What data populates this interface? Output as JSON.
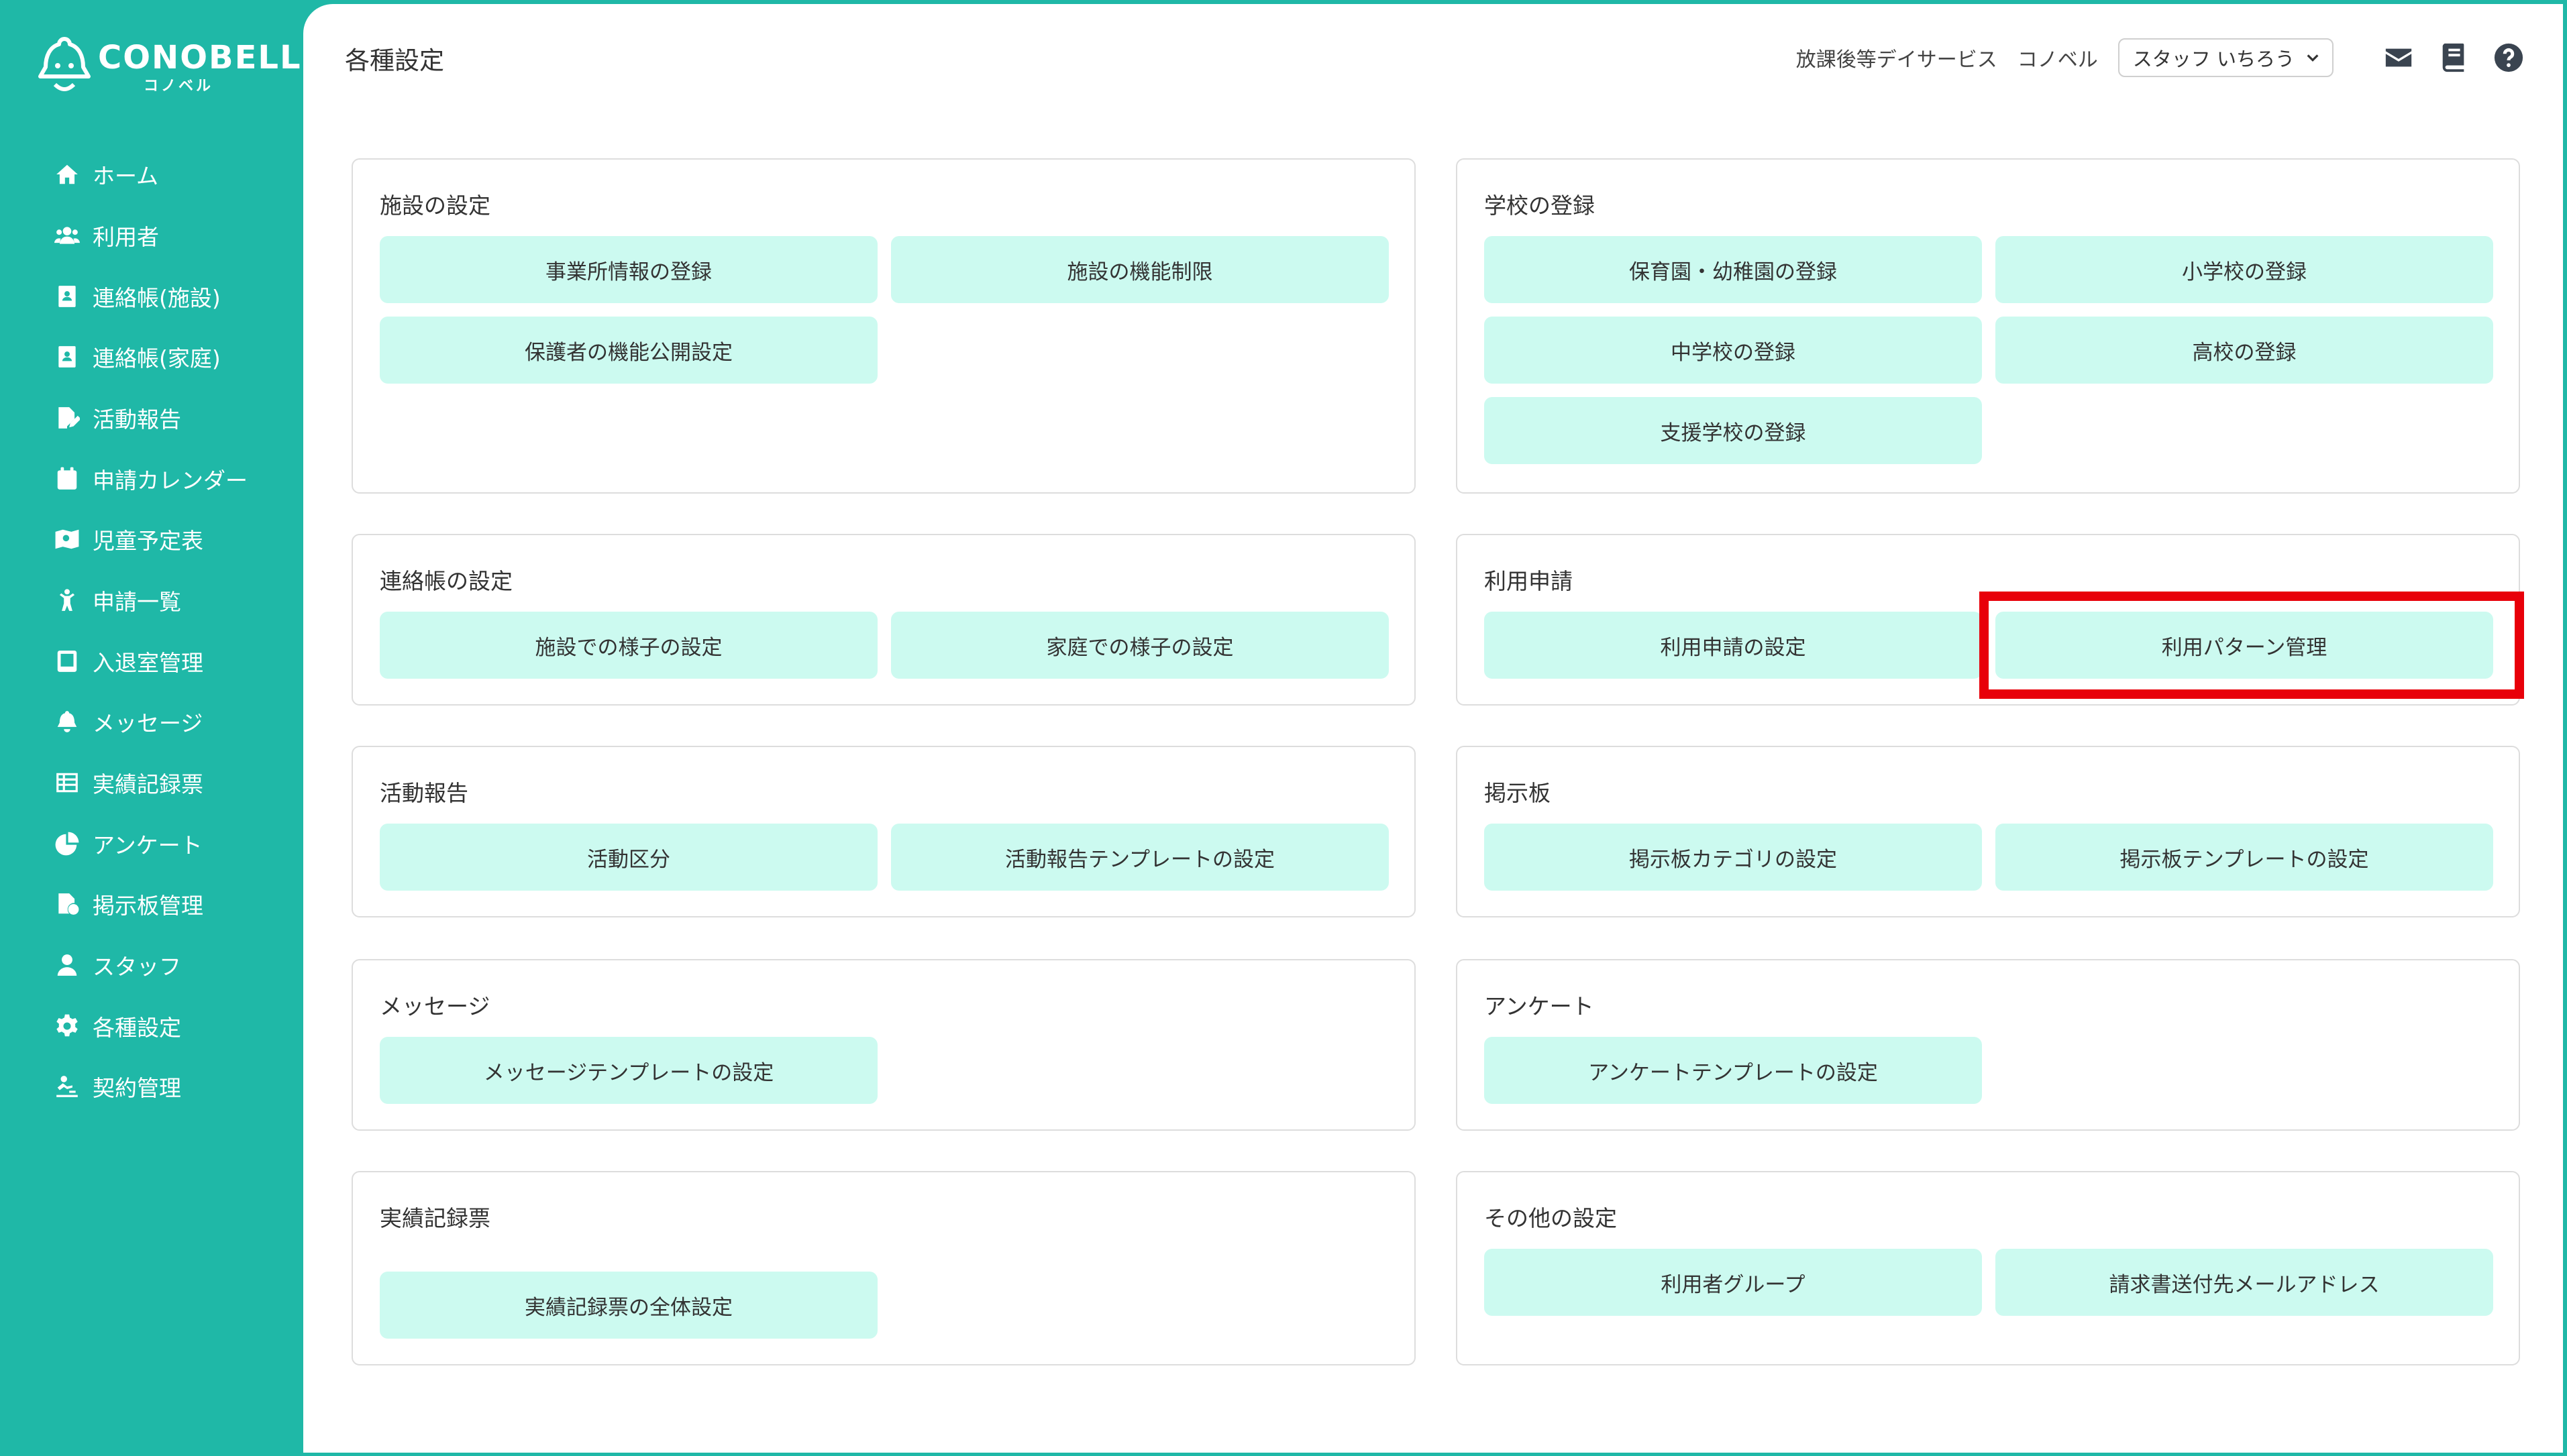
{
  "brand": {
    "name": "CONOBELL",
    "sub": "コノベル"
  },
  "sidebar": {
    "items": [
      {
        "label": "ホーム",
        "icon": "home-icon"
      },
      {
        "label": "利用者",
        "icon": "users-icon"
      },
      {
        "label": "連絡帳(施設)",
        "icon": "contact-book-icon"
      },
      {
        "label": "連絡帳(家庭)",
        "icon": "contact-book-icon"
      },
      {
        "label": "活動報告",
        "icon": "report-edit-icon"
      },
      {
        "label": "申請カレンダー",
        "icon": "calendar-icon"
      },
      {
        "label": "児童予定表",
        "icon": "map-icon"
      },
      {
        "label": "申請一覧",
        "icon": "child-icon"
      },
      {
        "label": "入退室管理",
        "icon": "tablet-icon"
      },
      {
        "label": "メッセージ",
        "icon": "bell-icon"
      },
      {
        "label": "実績記録票",
        "icon": "table-icon"
      },
      {
        "label": "アンケート",
        "icon": "pie-chart-icon"
      },
      {
        "label": "掲示板管理",
        "icon": "board-icon"
      },
      {
        "label": "スタッフ",
        "icon": "staff-icon"
      },
      {
        "label": "各種設定",
        "icon": "gear-icon"
      },
      {
        "label": "契約管理",
        "icon": "contract-icon"
      }
    ]
  },
  "header": {
    "title": "各種設定",
    "facility": "放課後等デイサービス",
    "org": "コノベル",
    "staff_select": "スタッフ いちろう"
  },
  "cards": {
    "facility": {
      "title": "施設の設定",
      "buttons": [
        "事業所情報の登録",
        "施設の機能制限",
        "保護者の機能公開設定"
      ]
    },
    "school": {
      "title": "学校の登録",
      "buttons": [
        "保育園・幼稚園の登録",
        "小学校の登録",
        "中学校の登録",
        "高校の登録",
        "支援学校の登録"
      ]
    },
    "contact": {
      "title": "連絡帳の設定",
      "buttons": [
        "施設での様子の設定",
        "家庭での様子の設定"
      ]
    },
    "usage": {
      "title": "利用申請",
      "buttons": [
        "利用申請の設定",
        "利用パターン管理"
      ]
    },
    "activity": {
      "title": "活動報告",
      "buttons": [
        "活動区分",
        "活動報告テンプレートの設定"
      ]
    },
    "board": {
      "title": "掲示板",
      "buttons": [
        "掲示板カテゴリの設定",
        "掲示板テンプレートの設定"
      ]
    },
    "message": {
      "title": "メッセージ",
      "buttons": [
        "メッセージテンプレートの設定"
      ]
    },
    "survey": {
      "title": "アンケート",
      "buttons": [
        "アンケートテンプレートの設定"
      ]
    },
    "record": {
      "title": "実績記録票",
      "buttons": [
        "実績記録票の全体設定"
      ]
    },
    "other": {
      "title": "その他の設定",
      "buttons": [
        "利用者グループ",
        "請求書送付先メールアドレス"
      ]
    }
  },
  "colors": {
    "accent": "#1fb8a7",
    "button_bg": "#ccfaf0",
    "highlight": "#e8000a"
  }
}
